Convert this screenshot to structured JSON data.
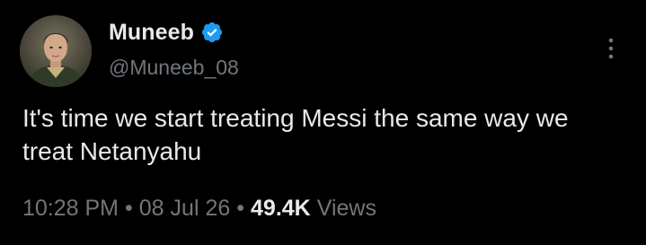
{
  "user": {
    "display_name": "Muneeb",
    "handle": "@Muneeb_08",
    "verified": true,
    "verified_badge_icon": "verified-check-icon",
    "avatar_icon": "profile-photo"
  },
  "tweet": {
    "text": "It's time we start treating Messi the same way we treat Netanyahu"
  },
  "meta": {
    "time": "10:28 PM",
    "separator": "•",
    "date": "08 Jul 26",
    "views_count": "49.4K",
    "views_label": "Views"
  },
  "actions": {
    "more_icon": "more-vertical-icon"
  },
  "colors": {
    "background": "#000000",
    "primary_text": "#e7e9ea",
    "secondary_text": "#71767b",
    "verified_blue": "#1d9bf0"
  }
}
